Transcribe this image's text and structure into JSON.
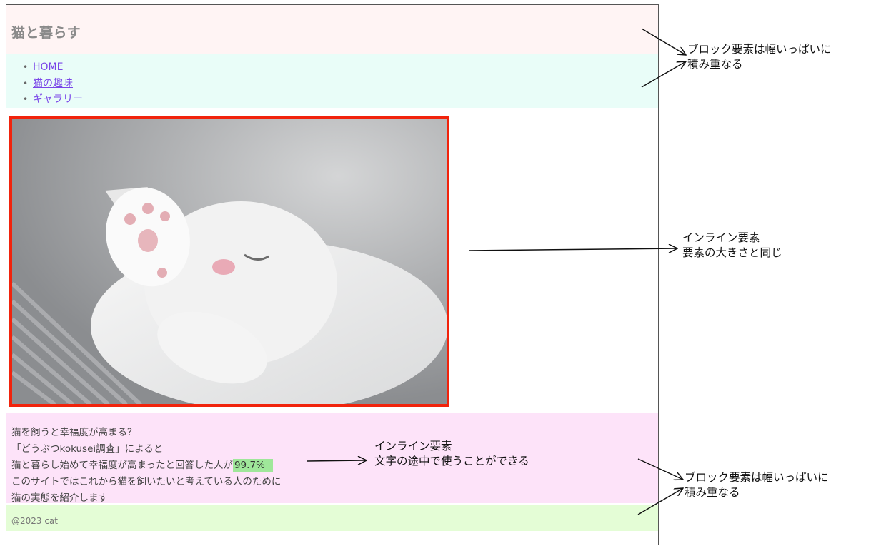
{
  "site": {
    "title": "猫と暮らす",
    "nav": [
      "HOME",
      "猫の趣味",
      "ギャラリー"
    ],
    "content_lines": {
      "line1": "猫を飼うと幸福度が高まる？",
      "line2": "「どうぶつkokusei調査」によると",
      "line3_before": "猫と暮らし始めて幸福度が高まったと回答した人が",
      "line3_highlight": "99.7%",
      "line4": "このサイトではこれから猫を飼いたいと考えている人のために",
      "line5": "猫の実態を紹介します"
    },
    "footer": "@2023 cat"
  },
  "annotations": {
    "block_top": [
      "ブロック要素は幅いっぱいに",
      "積み重なる"
    ],
    "inline_image": [
      "インライン要素",
      "要素の大きさと同じ"
    ],
    "inline_text": [
      "インライン要素",
      "文字の途中で使うことができる"
    ],
    "block_bottom": [
      "ブロック要素は幅いっぱいに",
      "積み重なる"
    ]
  },
  "colors": {
    "header_bg": "#fff4f4",
    "nav_bg": "#e9fdf8",
    "content_bg": "#fde3f9",
    "footer_bg": "#e4fdd6",
    "image_border": "#f1230c",
    "highlight_bg": "#9fe79a"
  },
  "image": {
    "alt": "white-cat-sleeping"
  }
}
